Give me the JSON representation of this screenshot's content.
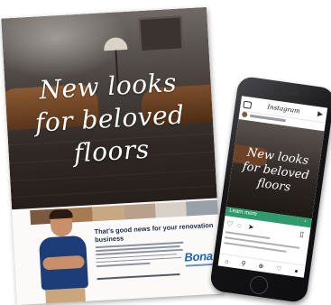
{
  "flyer": {
    "headline": "New looks for beloved floors",
    "good_news": "That's good news for your renovation business",
    "brand": "Bona",
    "swatch_colors": [
      "#7a5a3e",
      "#a67a52",
      "#c8a882",
      "#b9a08a",
      "#d8d1c8",
      "#9aa0a8"
    ]
  },
  "phone": {
    "app_title": "Instagram",
    "headline": "New looks for beloved floors",
    "learn_more": "Learn more",
    "icons": [
      "heart-icon",
      "comment-icon",
      "send-icon",
      "bookmark-icon",
      "home-icon",
      "search-icon",
      "add-icon",
      "like-icon",
      "profile-icon"
    ]
  },
  "colors": {
    "brand_blue": "#1e64b4",
    "cta_green": "#2f9b6d",
    "navy": "#1c2b4a"
  }
}
